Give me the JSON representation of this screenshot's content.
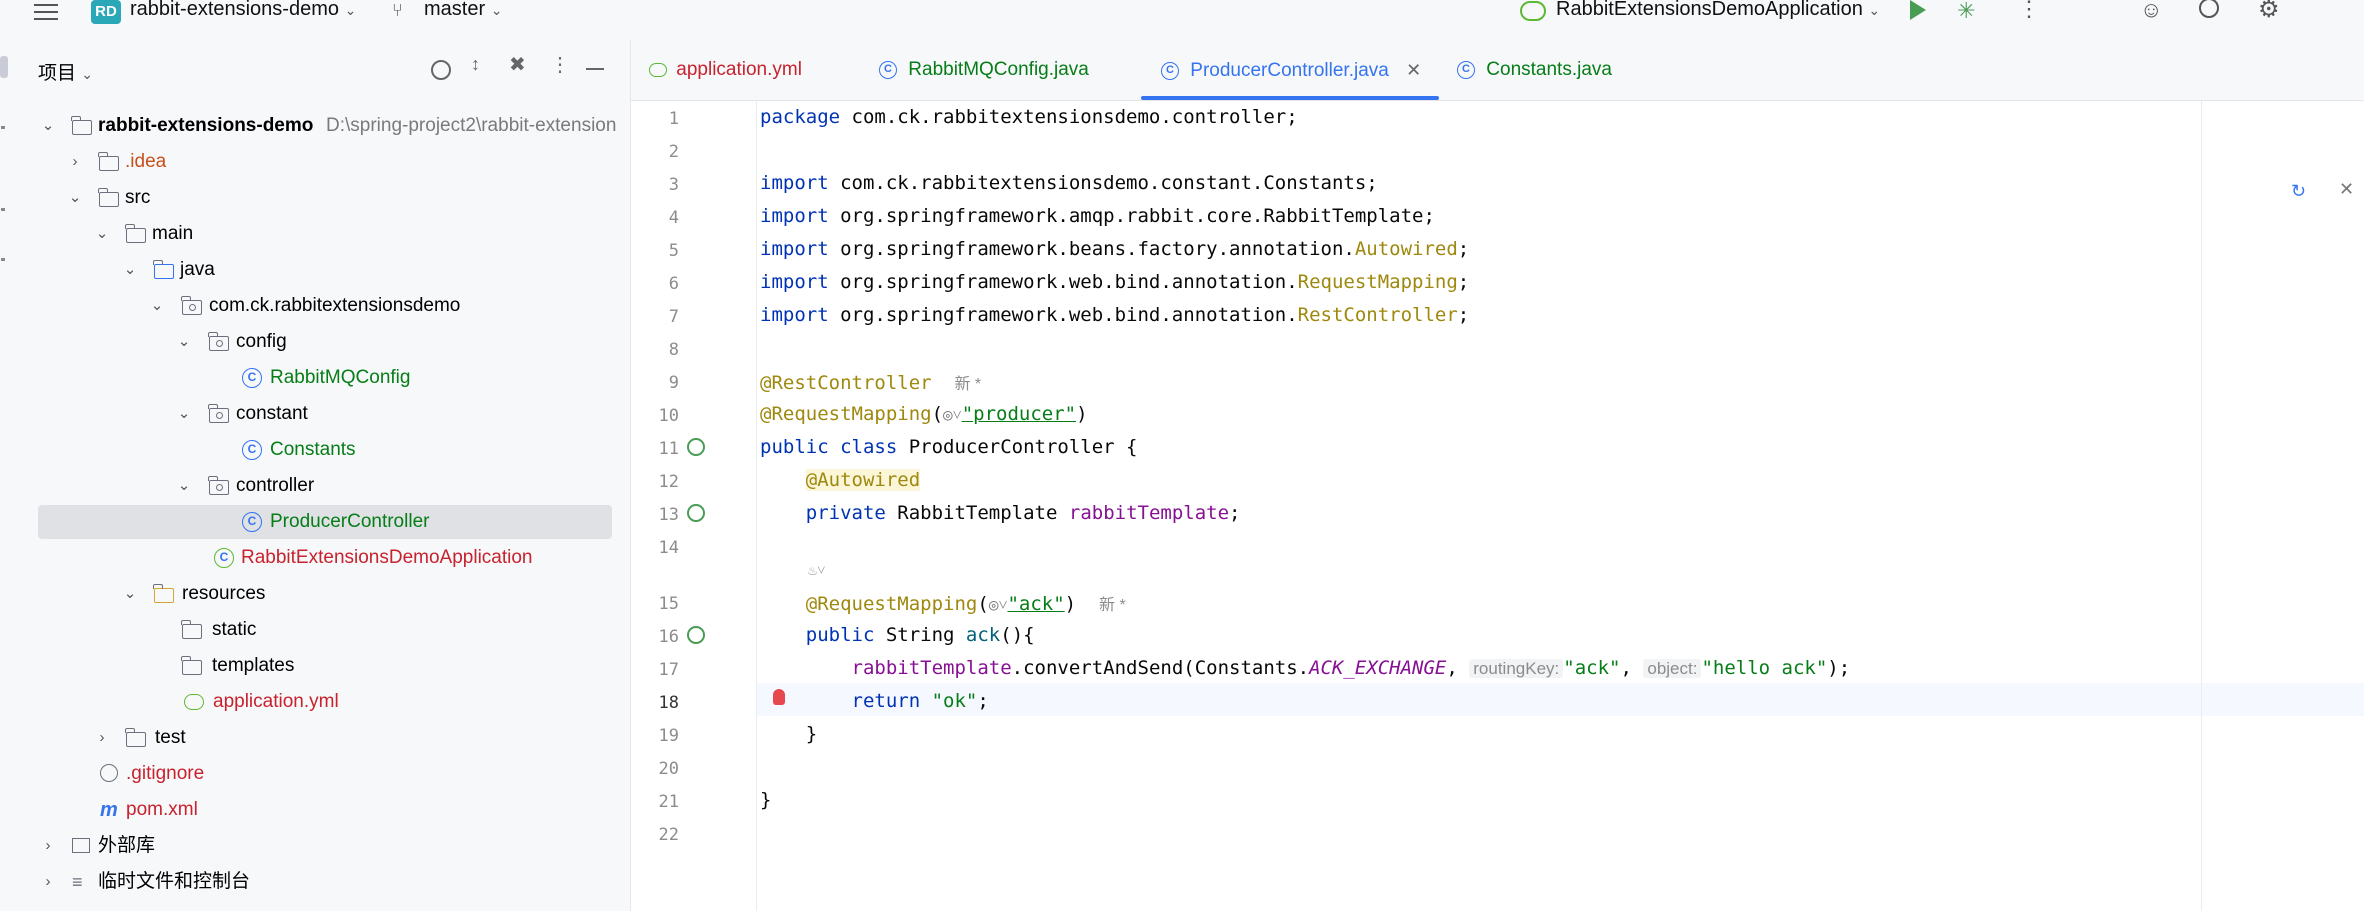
{
  "toolbar": {
    "project_badge": "RD",
    "project_name": "rabbit-extensions-demo",
    "branch": "master",
    "run_config": "RabbitExtensionsDemoApplication"
  },
  "project_panel": {
    "title": "项目",
    "root": {
      "name": "rabbit-extensions-demo",
      "path": "D:\\spring-project2\\rabbit-extension"
    },
    "items": [
      {
        "label": ".idea",
        "color": "#c94f1a"
      },
      {
        "label": "src"
      },
      {
        "label": "main"
      },
      {
        "label": "java"
      },
      {
        "label": "com.ck.rabbitextensionsdemo"
      },
      {
        "label": "config"
      },
      {
        "label": "RabbitMQConfig",
        "color": "#067d17"
      },
      {
        "label": "constant"
      },
      {
        "label": "Constants",
        "color": "#067d17"
      },
      {
        "label": "controller"
      },
      {
        "label": "ProducerController",
        "color": "#067d17"
      },
      {
        "label": "RabbitExtensionsDemoApplication",
        "color": "#c7222d"
      },
      {
        "label": "resources"
      },
      {
        "label": "static"
      },
      {
        "label": "templates"
      },
      {
        "label": "application.yml",
        "color": "#c7222d"
      },
      {
        "label": "test"
      },
      {
        "label": ".gitignore",
        "color": "#c7222d"
      },
      {
        "label": "pom.xml",
        "color": "#c7222d"
      },
      {
        "label": "外部库"
      },
      {
        "label": "临时文件和控制台"
      }
    ]
  },
  "tabs": [
    {
      "label": "application.yml",
      "color": "#c7222d"
    },
    {
      "label": "RabbitMQConfig.java",
      "color": "#067d17"
    },
    {
      "label": "ProducerController.java",
      "color": "#3574f0",
      "active": true
    },
    {
      "label": "Constants.java",
      "color": "#067d17"
    }
  ],
  "editor": {
    "line_numbers": [
      "1",
      "2",
      "3",
      "4",
      "5",
      "6",
      "7",
      "8",
      "9",
      "10",
      "11",
      "12",
      "13",
      "14",
      "15",
      "16",
      "17",
      "18",
      "19",
      "20",
      "21",
      "22"
    ],
    "code": {
      "l1_kw": "package",
      "l1_rest": " com.ck.rabbitextensionsdemo.controller;",
      "import_kw": "import",
      "l3": " com.ck.rabbitextensionsdemo.constant.Constants;",
      "l4": " org.springframework.amqp.rabbit.core.RabbitTemplate;",
      "l5_a": " org.springframework.beans.factory.annotation.",
      "l5_b": "Autowired",
      "l6_a": " org.springframework.web.bind.annotation.",
      "l6_b": "RequestMapping",
      "l7_a": " org.springframework.web.bind.annotation.",
      "l7_b": "RestController",
      "semicolon": ";",
      "l9_ann": "@RestController",
      "new_mark": "新 *",
      "l10_ann": "@RequestMapping",
      "l10_str": "\"producer\"",
      "l11_kw": "public class",
      "l11_rest": " ProducerController {",
      "l12_ann": "@Autowired",
      "l13_kw": "private",
      "l13_type": " RabbitTemplate ",
      "l13_fld": "rabbitTemplate",
      "l15_ann": "@RequestMapping",
      "l15_str": "\"ack\"",
      "l16_kw": "public",
      "l16_type": " String ",
      "l16_mth": "ack",
      "l16_rest": "(){",
      "l17_fld": "rabbitTemplate",
      "l17_a": ".convertAndSend(Constants.",
      "l17_cst": "ACK_EXCHANGE",
      "l17_hint1": "routingKey:",
      "l17_str1": "\"ack\"",
      "l17_hint2": "object:",
      "l17_str2": "\"hello ack\"",
      "l18_kw": "return",
      "l18_str": "\"ok\"",
      "l19": "}",
      "l21": "}"
    }
  }
}
